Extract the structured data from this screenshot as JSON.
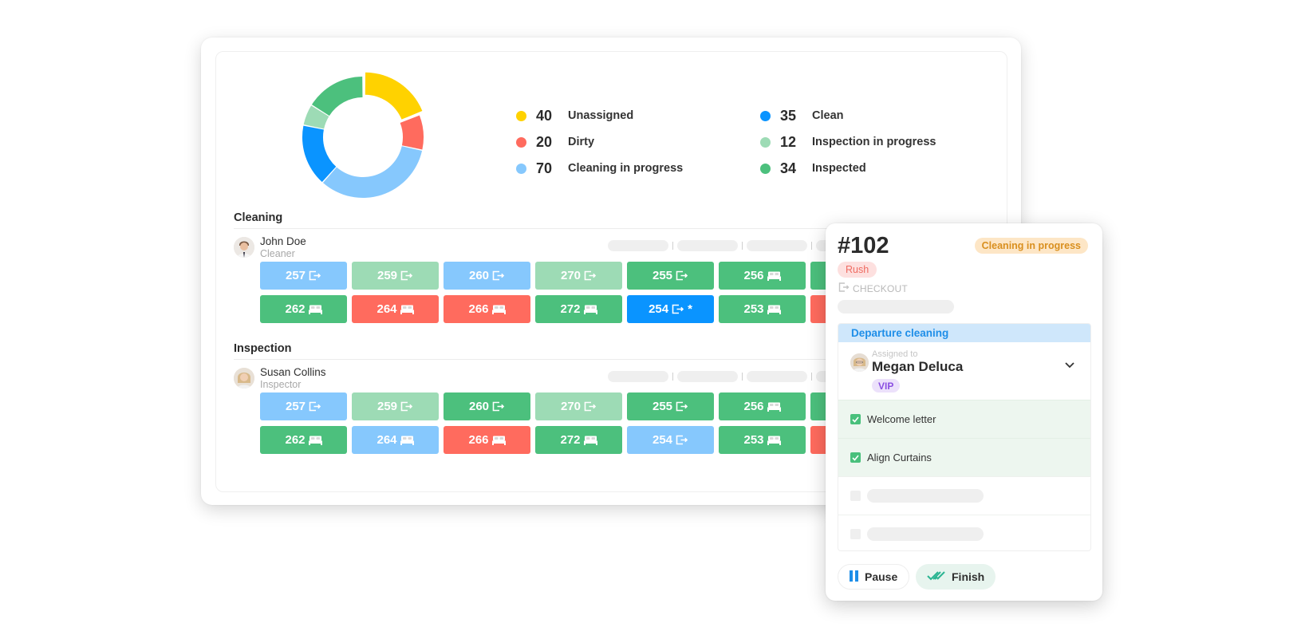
{
  "chart_data": {
    "type": "pie",
    "variant": "donut",
    "title": "",
    "legend_position": "right",
    "categories": [
      "Unassigned",
      "Dirty",
      "Cleaning in progress",
      "Clean",
      "Inspection in progress",
      "Inspected"
    ],
    "values": [
      40,
      20,
      70,
      35,
      12,
      34
    ],
    "colors": [
      "#ffd200",
      "#ff6b5e",
      "#86c8fd",
      "#0a94ff",
      "#9ddbb5",
      "#4cc07d"
    ],
    "exploded": [
      "Unassigned"
    ]
  },
  "legend": [
    {
      "value": "40",
      "label": "Unassigned",
      "color": "#ffd200"
    },
    {
      "value": "20",
      "label": "Dirty",
      "color": "#ff6b5e"
    },
    {
      "value": "70",
      "label": "Cleaning in progress",
      "color": "#86c8fd"
    },
    {
      "value": "35",
      "label": "Clean",
      "color": "#0a94ff"
    },
    {
      "value": "12",
      "label": "Inspection in progress",
      "color": "#9ddbb5"
    },
    {
      "value": "34",
      "label": "Inspected",
      "color": "#4cc07d"
    }
  ],
  "status_colors": {
    "cleaning_in_progress": "#86c8fd",
    "inspection_in_progress": "#9ddbb5",
    "inspected": "#4cc07d",
    "dirty": "#ff6b5e",
    "clean": "#0a94ff"
  },
  "sections": [
    {
      "title": "Cleaning",
      "person": {
        "name": "John Doe",
        "role": "Cleaner"
      },
      "rows": [
        [
          {
            "room": "257",
            "icon": "checkout-icon",
            "status": "cleaning_in_progress"
          },
          {
            "room": "259",
            "icon": "checkout-icon",
            "status": "inspection_in_progress"
          },
          {
            "room": "260",
            "icon": "checkout-icon",
            "status": "cleaning_in_progress"
          },
          {
            "room": "270",
            "icon": "checkout-icon",
            "status": "inspection_in_progress"
          },
          {
            "room": "255",
            "icon": "checkout-icon",
            "status": "inspected"
          },
          {
            "room": "256",
            "icon": "bed-icon",
            "status": "inspected"
          },
          {
            "room": "",
            "icon": "",
            "status": "inspected"
          }
        ],
        [
          {
            "room": "262",
            "icon": "bed-icon",
            "status": "inspected"
          },
          {
            "room": "264",
            "icon": "bed-icon",
            "status": "dirty"
          },
          {
            "room": "266",
            "icon": "bed-icon",
            "status": "dirty"
          },
          {
            "room": "272",
            "icon": "bed-icon",
            "status": "inspected"
          },
          {
            "room": "254",
            "icon": "checkout-icon",
            "status": "clean",
            "star": "*"
          },
          {
            "room": "253",
            "icon": "bed-icon",
            "status": "inspected"
          },
          {
            "room": "",
            "icon": "",
            "status": "dirty"
          }
        ]
      ]
    },
    {
      "title": "Inspection",
      "person": {
        "name": "Susan Collins",
        "role": "Inspector"
      },
      "rows": [
        [
          {
            "room": "257",
            "icon": "checkout-icon",
            "status": "cleaning_in_progress"
          },
          {
            "room": "259",
            "icon": "checkout-icon",
            "status": "inspection_in_progress"
          },
          {
            "room": "260",
            "icon": "checkout-icon",
            "status": "inspected"
          },
          {
            "room": "270",
            "icon": "checkout-icon",
            "status": "inspection_in_progress"
          },
          {
            "room": "255",
            "icon": "checkout-icon",
            "status": "inspected"
          },
          {
            "room": "256",
            "icon": "bed-icon",
            "status": "inspected"
          },
          {
            "room": "",
            "icon": "",
            "status": "inspected"
          }
        ],
        [
          {
            "room": "262",
            "icon": "bed-icon",
            "status": "inspected"
          },
          {
            "room": "264",
            "icon": "bed-icon",
            "status": "cleaning_in_progress"
          },
          {
            "room": "266",
            "icon": "bed-icon",
            "status": "dirty"
          },
          {
            "room": "272",
            "icon": "bed-icon",
            "status": "inspected"
          },
          {
            "room": "254",
            "icon": "checkout-icon",
            "status": "cleaning_in_progress"
          },
          {
            "room": "253",
            "icon": "bed-icon",
            "status": "inspected"
          },
          {
            "room": "",
            "icon": "",
            "status": "dirty"
          }
        ]
      ]
    }
  ],
  "popup": {
    "room": "#102",
    "status": "Cleaning in progress",
    "priority": "Rush",
    "type": "CHECKOUT",
    "task_title": "Departure cleaning",
    "assigned_label": "Assigned to",
    "assignee": "Megan Deluca",
    "assignee_badge": "VIP",
    "checklist": [
      {
        "label": "Welcome letter",
        "checked": true
      },
      {
        "label": "Align Curtains",
        "checked": true
      },
      {
        "label": "",
        "checked": false
      },
      {
        "label": "",
        "checked": false
      }
    ],
    "pause_label": "Pause",
    "finish_label": "Finish"
  }
}
